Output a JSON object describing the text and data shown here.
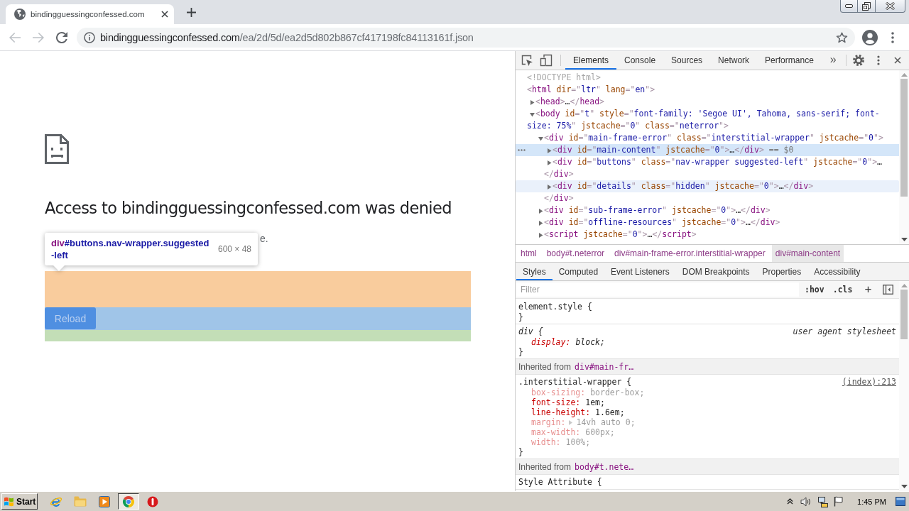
{
  "browser": {
    "tab": {
      "title": "bindingguessingconfessed.com",
      "selected": true
    },
    "nav_buttons": [
      {
        "kind": "back",
        "disabled": true
      },
      {
        "kind": "forward",
        "disabled": true
      },
      {
        "kind": "reload",
        "disabled": false
      }
    ],
    "address": {
      "host": "bindingguessingconfessed.com",
      "path": "/ea/2d/5d/ea2d5d802b867cf417198fc84113161f.json"
    }
  },
  "page": {
    "heading": "Access to bindingguessingconfessed.com was denied",
    "text_fragment": "e.",
    "button": {
      "label": "Reload"
    },
    "inspect_tooltip": {
      "tag": "div",
      "selector_lines": [
        "#buttons.nav-wrapper.suggested",
        "-left"
      ],
      "size": "600 × 48"
    }
  },
  "devtools": {
    "tabs": [
      {
        "label": "Elements",
        "selected": true
      },
      {
        "label": "Console",
        "selected": false
      },
      {
        "label": "Sources",
        "selected": false
      },
      {
        "label": "Network",
        "selected": false
      },
      {
        "label": "Performance",
        "selected": false
      }
    ],
    "overflow": "»",
    "dom_tree": [
      {
        "expandable": false,
        "selected": false,
        "hovered": false,
        "lines": [
          [
            {
              "kind": "doctype",
              "text": "<!DOCTYPE html>"
            }
          ]
        ]
      },
      {
        "expandable": false,
        "selected": false,
        "hovered": false,
        "lines": [
          [
            {
              "kind": "punct",
              "text": "<"
            },
            {
              "kind": "tag",
              "text": "html"
            },
            {
              "kind": "attr",
              "text": " dir"
            },
            {
              "kind": "punct",
              "text": "=\""
            },
            {
              "kind": "value",
              "text": "ltr"
            },
            {
              "kind": "punct",
              "text": "\""
            },
            {
              "kind": "attr",
              "text": " lang"
            },
            {
              "kind": "punct",
              "text": "=\""
            },
            {
              "kind": "value",
              "text": "en"
            },
            {
              "kind": "punct",
              "text": "\">"
            }
          ]
        ],
        "children": [
          {
            "expandable": true,
            "selected": false,
            "hovered": false,
            "expanded": false,
            "lines": [
              [
                {
                  "kind": "punct",
                  "text": "<"
                },
                {
                  "kind": "tag",
                  "text": "head"
                },
                {
                  "kind": "punct",
                  "text": ">"
                },
                {
                  "kind": "plain",
                  "text": "…"
                },
                {
                  "kind": "punct",
                  "text": "</"
                },
                {
                  "kind": "tag",
                  "text": "head"
                },
                {
                  "kind": "punct",
                  "text": ">"
                }
              ]
            ]
          },
          {
            "expandable": true,
            "selected": false,
            "hovered": false,
            "expanded": true,
            "lines": [
              [
                {
                  "kind": "punct",
                  "text": "<"
                },
                {
                  "kind": "tag",
                  "text": "body"
                },
                {
                  "kind": "attr",
                  "text": " id"
                },
                {
                  "kind": "punct",
                  "text": "=\""
                },
                {
                  "kind": "value",
                  "text": "t"
                },
                {
                  "kind": "punct",
                  "text": "\""
                },
                {
                  "kind": "attr",
                  "text": " style"
                },
                {
                  "kind": "punct",
                  "text": "=\""
                },
                {
                  "kind": "value",
                  "text": "font-family: 'Segoe UI', Tahoma, sans-serif; font-"
                }
              ],
              [
                {
                  "kind": "value",
                  "text": "size: 75%"
                },
                {
                  "kind": "punct",
                  "text": "\""
                },
                {
                  "kind": "attr",
                  "text": " jstcache"
                },
                {
                  "kind": "punct",
                  "text": "=\""
                },
                {
                  "kind": "value",
                  "text": "0"
                },
                {
                  "kind": "punct",
                  "text": "\""
                },
                {
                  "kind": "attr",
                  "text": " class"
                },
                {
                  "kind": "punct",
                  "text": "=\""
                },
                {
                  "kind": "value",
                  "text": "neterror"
                },
                {
                  "kind": "punct",
                  "text": "\">"
                }
              ]
            ],
            "children": [
              {
                "expandable": true,
                "selected": false,
                "hovered": false,
                "expanded": true,
                "lines": [
                  [
                    {
                      "kind": "punct",
                      "text": "<"
                    },
                    {
                      "kind": "tag",
                      "text": "div"
                    },
                    {
                      "kind": "attr",
                      "text": " id"
                    },
                    {
                      "kind": "punct",
                      "text": "=\""
                    },
                    {
                      "kind": "value",
                      "text": "main-frame-error"
                    },
                    {
                      "kind": "punct",
                      "text": "\""
                    },
                    {
                      "kind": "attr",
                      "text": " class"
                    },
                    {
                      "kind": "punct",
                      "text": "=\""
                    },
                    {
                      "kind": "value",
                      "text": "interstitial-wrapper"
                    },
                    {
                      "kind": "punct",
                      "text": "\""
                    },
                    {
                      "kind": "attr",
                      "text": " jstcache"
                    },
                    {
                      "kind": "punct",
                      "text": "=\""
                    },
                    {
                      "kind": "value",
                      "text": "0"
                    },
                    {
                      "kind": "punct",
                      "text": "\">"
                    }
                  ]
                ],
                "children": [
                  {
                    "expandable": true,
                    "selected": true,
                    "hovered": false,
                    "expanded": false,
                    "lines": [
                      [
                        {
                          "kind": "punct",
                          "text": "<"
                        },
                        {
                          "kind": "tag",
                          "text": "div"
                        },
                        {
                          "kind": "attr",
                          "text": " id"
                        },
                        {
                          "kind": "punct",
                          "text": "=\""
                        },
                        {
                          "kind": "value",
                          "text": "main-content"
                        },
                        {
                          "kind": "punct",
                          "text": "\""
                        },
                        {
                          "kind": "attr",
                          "text": " jstcache"
                        },
                        {
                          "kind": "punct",
                          "text": "=\""
                        },
                        {
                          "kind": "value",
                          "text": "0"
                        },
                        {
                          "kind": "punct",
                          "text": "\">"
                        },
                        {
                          "kind": "plain",
                          "text": "…"
                        },
                        {
                          "kind": "punct",
                          "text": "</"
                        },
                        {
                          "kind": "tag",
                          "text": "div"
                        },
                        {
                          "kind": "punct",
                          "text": ">"
                        },
                        {
                          "kind": "note",
                          "text": " == $0"
                        }
                      ]
                    ]
                  },
                  {
                    "expandable": true,
                    "selected": false,
                    "hovered": false,
                    "expanded": false,
                    "lines": [
                      [
                        {
                          "kind": "punct",
                          "text": "<"
                        },
                        {
                          "kind": "tag",
                          "text": "div"
                        },
                        {
                          "kind": "attr",
                          "text": " id"
                        },
                        {
                          "kind": "punct",
                          "text": "=\""
                        },
                        {
                          "kind": "value",
                          "text": "buttons"
                        },
                        {
                          "kind": "punct",
                          "text": "\""
                        },
                        {
                          "kind": "attr",
                          "text": " class"
                        },
                        {
                          "kind": "punct",
                          "text": "=\""
                        },
                        {
                          "kind": "value",
                          "text": "nav-wrapper suggested-left"
                        },
                        {
                          "kind": "punct",
                          "text": "\""
                        },
                        {
                          "kind": "attr",
                          "text": " jstcache"
                        },
                        {
                          "kind": "punct",
                          "text": "=\""
                        },
                        {
                          "kind": "value",
                          "text": "0"
                        },
                        {
                          "kind": "punct",
                          "text": "\">"
                        },
                        {
                          "kind": "plain",
                          "text": "…"
                        }
                      ],
                      [
                        {
                          "kind": "punct",
                          "text": "</"
                        },
                        {
                          "kind": "tag",
                          "text": "div"
                        },
                        {
                          "kind": "punct",
                          "text": ">"
                        }
                      ]
                    ]
                  },
                  {
                    "expandable": true,
                    "selected": false,
                    "hovered": true,
                    "expanded": false,
                    "lines": [
                      [
                        {
                          "kind": "punct",
                          "text": "<"
                        },
                        {
                          "kind": "tag",
                          "text": "div"
                        },
                        {
                          "kind": "attr",
                          "text": " id"
                        },
                        {
                          "kind": "punct",
                          "text": "=\""
                        },
                        {
                          "kind": "value",
                          "text": "details"
                        },
                        {
                          "kind": "punct",
                          "text": "\""
                        },
                        {
                          "kind": "attr",
                          "text": " class"
                        },
                        {
                          "kind": "punct",
                          "text": "=\""
                        },
                        {
                          "kind": "value",
                          "text": "hidden"
                        },
                        {
                          "kind": "punct",
                          "text": "\""
                        },
                        {
                          "kind": "attr",
                          "text": " jstcache"
                        },
                        {
                          "kind": "punct",
                          "text": "=\""
                        },
                        {
                          "kind": "value",
                          "text": "0"
                        },
                        {
                          "kind": "punct",
                          "text": "\">"
                        },
                        {
                          "kind": "plain",
                          "text": "…"
                        },
                        {
                          "kind": "punct",
                          "text": "</"
                        },
                        {
                          "kind": "tag",
                          "text": "div"
                        },
                        {
                          "kind": "punct",
                          "text": ">"
                        }
                      ]
                    ]
                  }
                ],
                "closing": [
                  {
                    "kind": "punct",
                    "text": "</"
                  },
                  {
                    "kind": "tag",
                    "text": "div"
                  },
                  {
                    "kind": "punct",
                    "text": ">"
                  }
                ]
              },
              {
                "expandable": true,
                "selected": false,
                "hovered": false,
                "expanded": false,
                "lines": [
                  [
                    {
                      "kind": "punct",
                      "text": "<"
                    },
                    {
                      "kind": "tag",
                      "text": "div"
                    },
                    {
                      "kind": "attr",
                      "text": " id"
                    },
                    {
                      "kind": "punct",
                      "text": "=\""
                    },
                    {
                      "kind": "value",
                      "text": "sub-frame-error"
                    },
                    {
                      "kind": "punct",
                      "text": "\""
                    },
                    {
                      "kind": "attr",
                      "text": " jstcache"
                    },
                    {
                      "kind": "punct",
                      "text": "=\""
                    },
                    {
                      "kind": "value",
                      "text": "0"
                    },
                    {
                      "kind": "punct",
                      "text": "\">"
                    },
                    {
                      "kind": "plain",
                      "text": "…"
                    },
                    {
                      "kind": "punct",
                      "text": "</"
                    },
                    {
                      "kind": "tag",
                      "text": "div"
                    },
                    {
                      "kind": "punct",
                      "text": ">"
                    }
                  ]
                ]
              },
              {
                "expandable": true,
                "selected": false,
                "hovered": false,
                "expanded": false,
                "lines": [
                  [
                    {
                      "kind": "punct",
                      "text": "<"
                    },
                    {
                      "kind": "tag",
                      "text": "div"
                    },
                    {
                      "kind": "attr",
                      "text": " id"
                    },
                    {
                      "kind": "punct",
                      "text": "=\""
                    },
                    {
                      "kind": "value",
                      "text": "offline-resources"
                    },
                    {
                      "kind": "punct",
                      "text": "\""
                    },
                    {
                      "kind": "attr",
                      "text": " jstcache"
                    },
                    {
                      "kind": "punct",
                      "text": "=\""
                    },
                    {
                      "kind": "value",
                      "text": "0"
                    },
                    {
                      "kind": "punct",
                      "text": "\">"
                    },
                    {
                      "kind": "plain",
                      "text": "…"
                    },
                    {
                      "kind": "punct",
                      "text": "</"
                    },
                    {
                      "kind": "tag",
                      "text": "div"
                    },
                    {
                      "kind": "punct",
                      "text": ">"
                    }
                  ]
                ]
              },
              {
                "expandable": true,
                "selected": false,
                "hovered": false,
                "expanded": false,
                "lines": [
                  [
                    {
                      "kind": "punct",
                      "text": "<"
                    },
                    {
                      "kind": "tag",
                      "text": "script"
                    },
                    {
                      "kind": "attr",
                      "text": " jstcache"
                    },
                    {
                      "kind": "punct",
                      "text": "=\""
                    },
                    {
                      "kind": "value",
                      "text": "0"
                    },
                    {
                      "kind": "punct",
                      "text": "\">"
                    },
                    {
                      "kind": "plain",
                      "text": "…"
                    },
                    {
                      "kind": "punct",
                      "text": "</"
                    },
                    {
                      "kind": "tag",
                      "text": "script"
                    },
                    {
                      "kind": "punct",
                      "text": ">"
                    }
                  ]
                ]
              }
            ]
          }
        ]
      }
    ],
    "breadcrumbs": [
      {
        "text": "html",
        "selected": false
      },
      {
        "text": "body#t.neterror",
        "selected": false
      },
      {
        "text": "div#main-frame-error.interstitial-wrapper",
        "selected": false
      },
      {
        "text": "div#main-content",
        "selected": true
      }
    ],
    "panel_tabs": [
      {
        "label": "Styles",
        "selected": true
      },
      {
        "label": "Computed",
        "selected": false
      },
      {
        "label": "Event Listeners",
        "selected": false
      },
      {
        "label": "DOM Breakpoints",
        "selected": false
      },
      {
        "label": "Properties",
        "selected": false
      },
      {
        "label": "Accessibility",
        "selected": false
      }
    ],
    "filter": {
      "placeholder": "Filter"
    },
    "filter_buttons": [
      ":hov",
      ".cls",
      "+"
    ],
    "styles": [
      {
        "kind": "rule",
        "header": "element.style {",
        "user_agent": false,
        "footer": "}"
      },
      {
        "kind": "rule",
        "header": "div {",
        "source": "user agent stylesheet",
        "user_agent": true,
        "properties": [
          {
            "name": "display:",
            "value": "block;",
            "inactive": false,
            "expandable": false
          }
        ],
        "footer": "}"
      },
      {
        "kind": "inherited",
        "label": "Inherited from",
        "selector": "div#main-fr…"
      },
      {
        "kind": "rule",
        "header": ".interstitial-wrapper {",
        "source": "(index):213",
        "user_agent": false,
        "properties": [
          {
            "name": "box-sizing:",
            "value": "border-box;",
            "inactive": true,
            "expandable": false
          },
          {
            "name": "font-size:",
            "value": "1em;",
            "inactive": false,
            "expandable": false
          },
          {
            "name": "line-height:",
            "value": "1.6em;",
            "inactive": false,
            "expandable": false
          },
          {
            "name": "margin:",
            "value": "14vh auto 0;",
            "inactive": true,
            "expandable": true
          },
          {
            "name": "max-width:",
            "value": "600px;",
            "inactive": true,
            "expandable": false
          },
          {
            "name": "width:",
            "value": "100%;",
            "inactive": true,
            "expandable": false
          }
        ],
        "footer": "}"
      },
      {
        "kind": "inherited",
        "label": "Inherited from",
        "selector": "body#t.nete…"
      },
      {
        "kind": "rule",
        "header": "Style Attribute {",
        "user_agent": false
      }
    ]
  },
  "taskbar": {
    "start": "Start",
    "apps": [
      {
        "kind": "globe_e",
        "selected": false
      },
      {
        "kind": "folder",
        "selected": false
      },
      {
        "kind": "player",
        "selected": false
      },
      {
        "kind": "browser",
        "selected": true
      },
      {
        "kind": "alert",
        "selected": false
      }
    ],
    "clock": "1:45 PM"
  }
}
